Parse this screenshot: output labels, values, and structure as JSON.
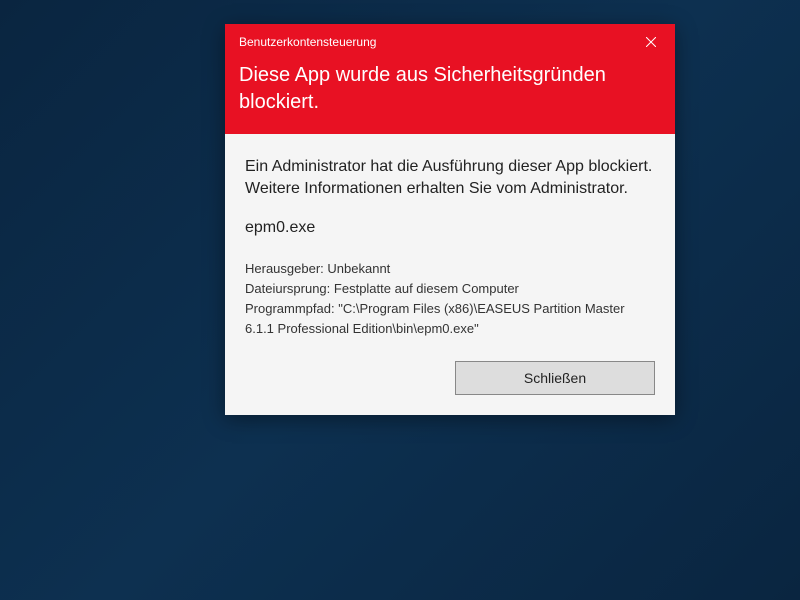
{
  "dialog": {
    "title": "Benutzerkontensteuerung",
    "header_message": "Diese App wurde aus Sicherheitsgründen blockiert.",
    "explanation": "Ein Administrator hat die Ausführung dieser App blockiert. Weitere Informationen erhalten Sie vom Administrator.",
    "filename": "epm0.exe",
    "details": {
      "publisher_label": "Herausgeber:",
      "publisher_value": "Unbekannt",
      "origin_label": "Dateiursprung:",
      "origin_value": "Festplatte auf diesem Computer",
      "path_label": "Programmpfad:",
      "path_value": "\"C:\\Program Files (x86)\\EASEUS Partition Master 6.1.1 Professional Edition\\bin\\epm0.exe\""
    },
    "close_button": "Schließen"
  }
}
